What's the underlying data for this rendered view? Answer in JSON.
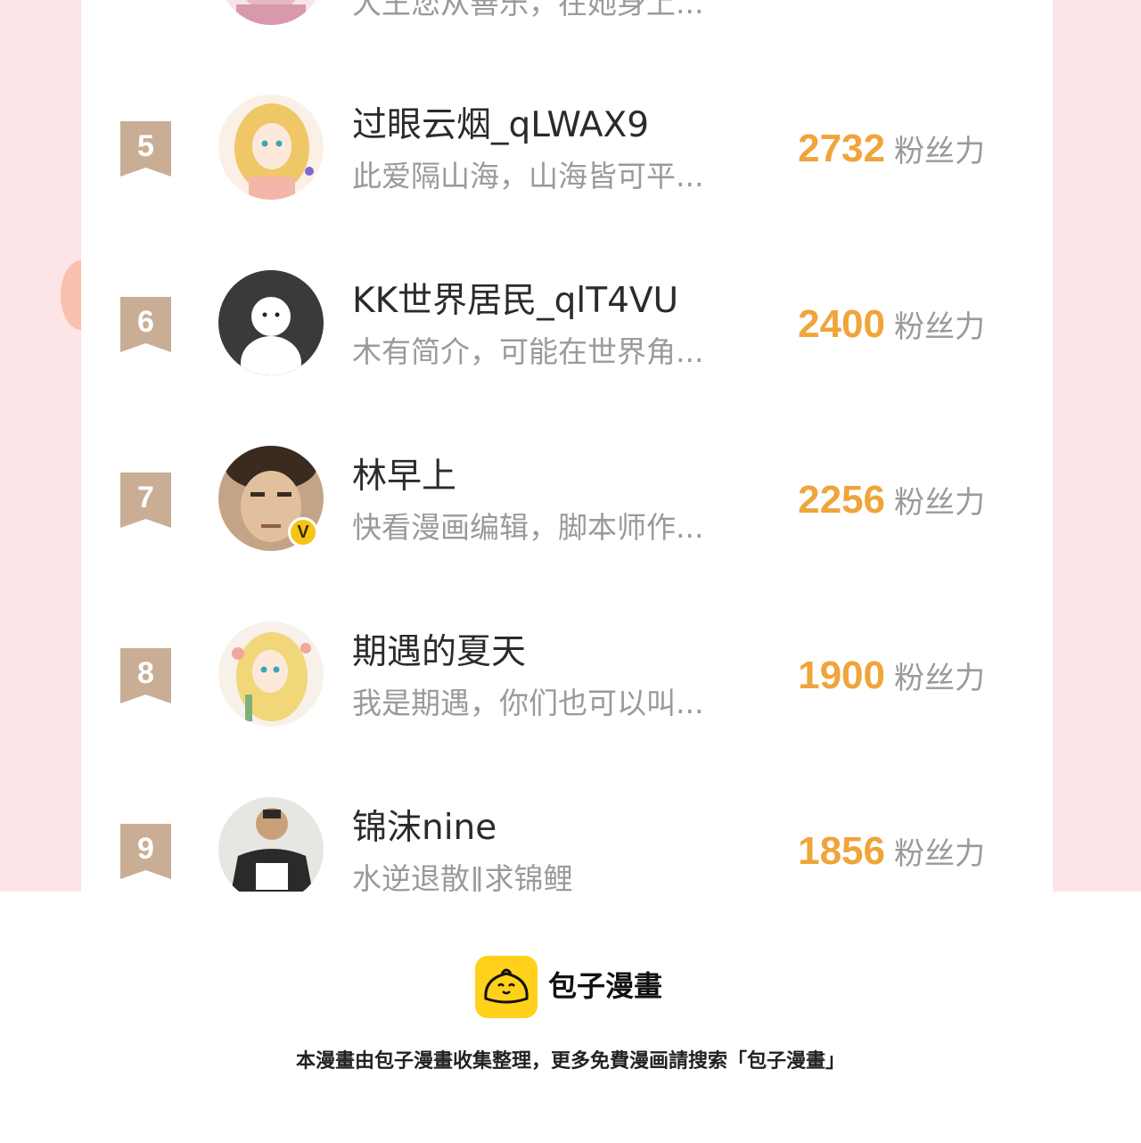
{
  "ranking": {
    "unit_label": "粉丝力",
    "partial_top_bio": "大王您从善乐，在她身上...",
    "rows": [
      {
        "rank": "5",
        "name": "过眼云烟_qLWAX9",
        "bio": "此爱隔山海，山海皆可平...",
        "fans": "2732",
        "verified": false
      },
      {
        "rank": "6",
        "name": "KK世界居民_qlT4VU",
        "bio": "木有简介，可能在世界角...",
        "fans": "2400",
        "verified": false
      },
      {
        "rank": "7",
        "name": "林早上",
        "bio": "快看漫画编辑，脚本师作...",
        "fans": "2256",
        "verified": true,
        "verified_mark": "V"
      },
      {
        "rank": "8",
        "name": "期遇的夏天",
        "bio": "我是期遇，你们也可以叫...",
        "fans": "1900",
        "verified": false
      },
      {
        "rank": "9",
        "name": "锦沫nine",
        "bio": "水逆退散‖求锦鲤",
        "fans": "1856",
        "verified": false
      }
    ]
  },
  "footer": {
    "brand": "包子漫畫",
    "note": "本漫畫由包子漫畫收集整理，更多免費漫画請搜索「包子漫畫」"
  },
  "colors": {
    "page_bg": "#fde4e6",
    "rank_badge": "#c9ad95",
    "fans_number": "#f0a43a",
    "logo_yellow": "#ffd11a"
  }
}
